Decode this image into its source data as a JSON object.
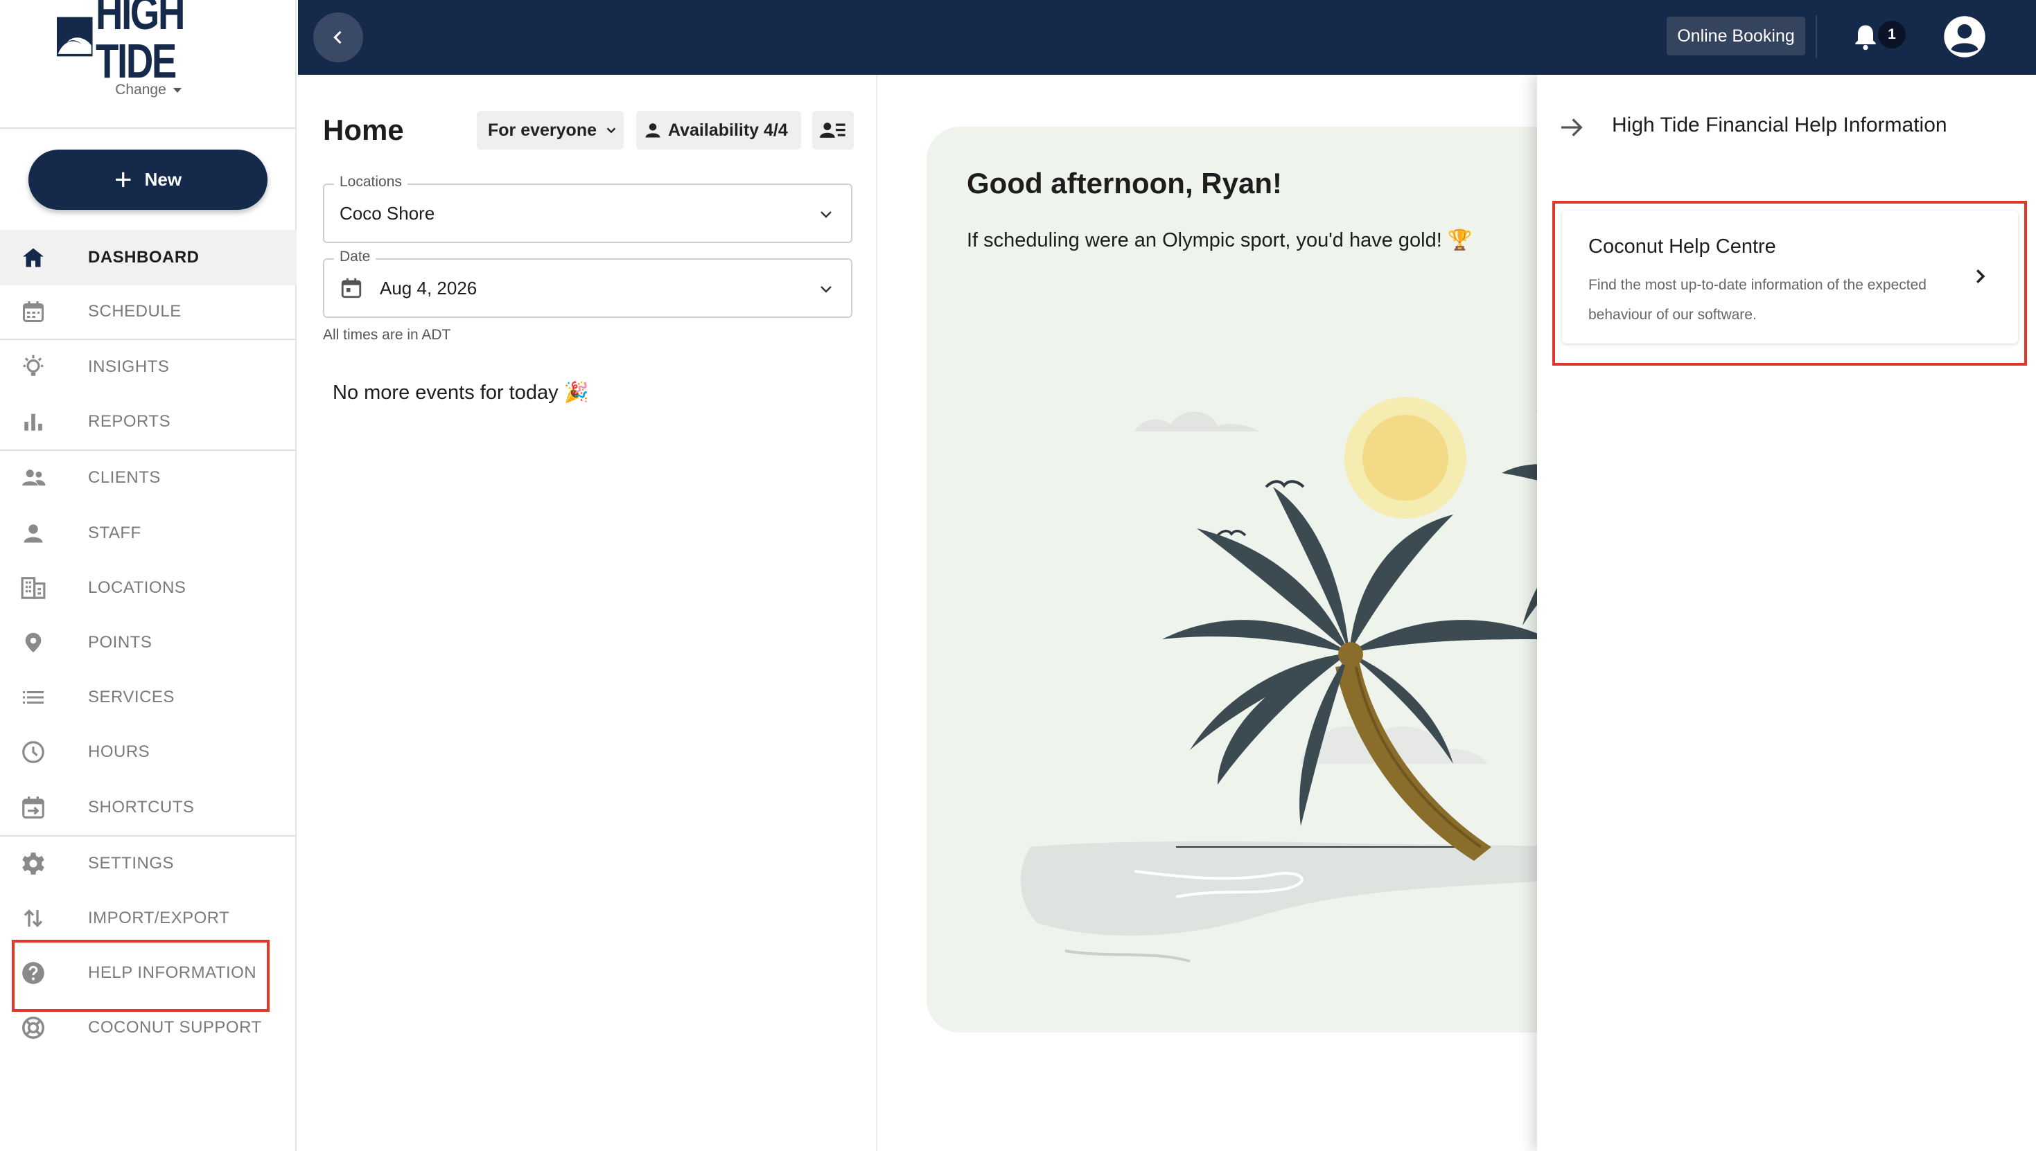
{
  "brand": {
    "logo_text": "HIGH TIDE",
    "change_label": "Change",
    "primary_color": "#15294b"
  },
  "sidebar": {
    "new_button": "New",
    "items": [
      {
        "label": "DASHBOARD",
        "icon": "home-icon",
        "active": true
      },
      {
        "label": "SCHEDULE",
        "icon": "calendar-icon"
      },
      {
        "label": "INSIGHTS",
        "icon": "lightbulb-icon"
      },
      {
        "label": "REPORTS",
        "icon": "bar-chart-icon"
      },
      {
        "label": "CLIENTS",
        "icon": "people-icon"
      },
      {
        "label": "STAFF",
        "icon": "person-icon"
      },
      {
        "label": "LOCATIONS",
        "icon": "building-icon"
      },
      {
        "label": "POINTS",
        "icon": "map-pin-icon"
      },
      {
        "label": "SERVICES",
        "icon": "list-icon"
      },
      {
        "label": "HOURS",
        "icon": "clock-icon"
      },
      {
        "label": "SHORTCUTS",
        "icon": "shortcut-icon"
      },
      {
        "label": "SETTINGS",
        "icon": "gear-icon"
      },
      {
        "label": "IMPORT/EXPORT",
        "icon": "swap-vertical-icon"
      },
      {
        "label": "HELP INFORMATION",
        "icon": "help-circle-icon",
        "highlighted": true
      },
      {
        "label": "COCONUT SUPPORT",
        "icon": "lifebuoy-icon"
      }
    ]
  },
  "topbar": {
    "online_booking": "Online Booking",
    "notification_count": "1"
  },
  "home": {
    "title": "Home",
    "filter_everyone": "For everyone",
    "availability": "Availability 4/4",
    "locations_label": "Locations",
    "location_value": "Coco Shore",
    "date_label": "Date",
    "date_value": "Aug 4, 2026",
    "timezone_note": "All times are in ADT",
    "empty_message": "No more events for today 🎉"
  },
  "greeting": {
    "title": "Good afternoon, Ryan!",
    "subtitle": "If scheduling were an Olympic sport, you'd have gold! 🏆"
  },
  "drawer": {
    "title": "High Tide Financial Help Information",
    "card_title": "Coconut Help Centre",
    "card_description": "Find the most up-to-date information of the expected behaviour of our software."
  },
  "colors": {
    "highlight": "#e0372b",
    "card_background": "#eef3ec"
  }
}
